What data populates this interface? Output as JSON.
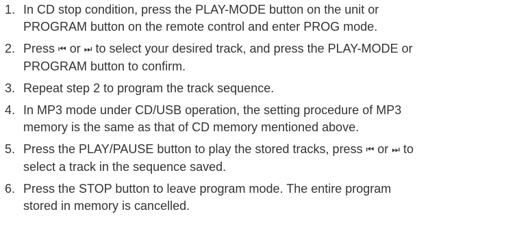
{
  "steps": [
    {
      "number": "1.",
      "line1": "In CD stop condition, press the PLAY-MODE button on the unit or",
      "line2": "PROGRAM button on the remote control and enter PROG mode."
    },
    {
      "number": "2.",
      "pre": "Press ",
      "prev_icon": "⏮",
      "mid": " or ",
      "next_icon": "⏭",
      "post": " to select your desired track, and press the PLAY-MODE or",
      "line2": "PROGRAM button to confirm."
    },
    {
      "number": "3.",
      "line1": "Repeat step 2 to program the track sequence."
    },
    {
      "number": "4.",
      "line1": "In MP3 mode under CD/USB operation, the setting procedure of MP3",
      "line2": "memory is the same as that of CD memory mentioned above."
    },
    {
      "number": "5.",
      "pre": "Press the PLAY/PAUSE button to play the stored tracks, press ",
      "prev_icon": "⏮",
      "mid": " or ",
      "next_icon": "⏭",
      "post": "  to",
      "line2": "select a track in the sequence saved."
    },
    {
      "number": "6.",
      "line1": "Press the STOP button to leave program mode. The entire program",
      "line2": "stored in memory is cancelled."
    }
  ]
}
